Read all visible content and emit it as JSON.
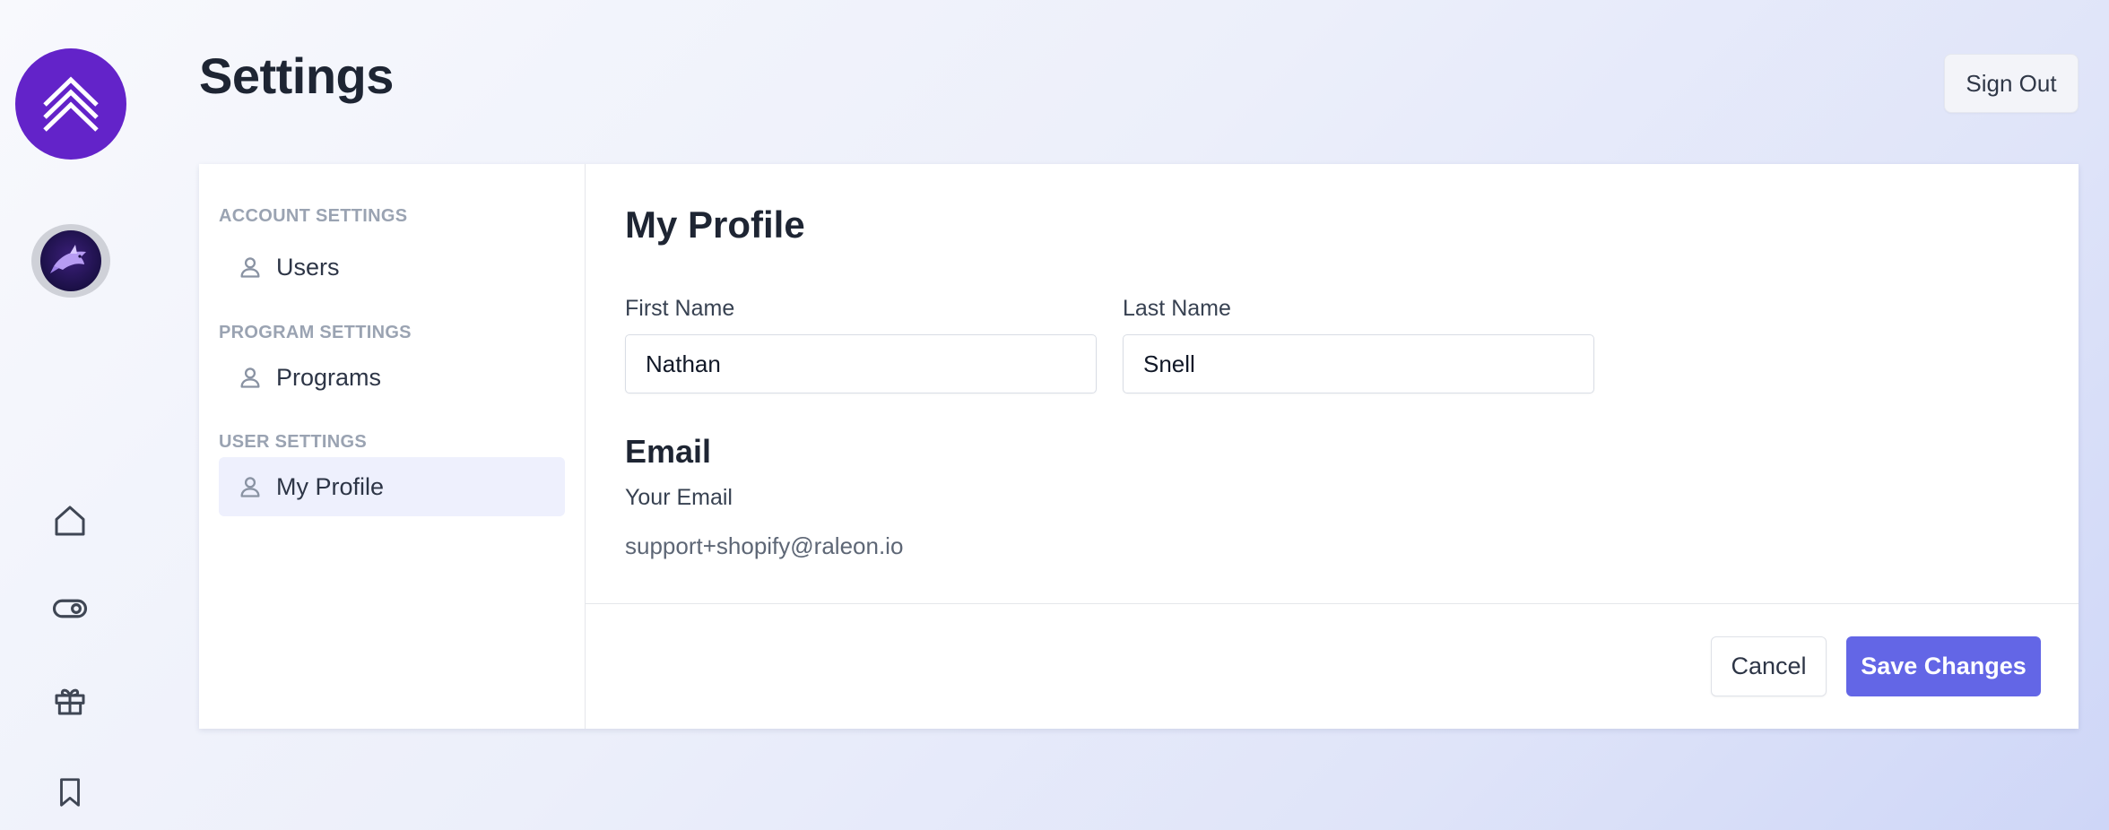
{
  "page": {
    "title": "Settings",
    "sign_out_label": "Sign Out"
  },
  "rail": {
    "icons": [
      "app-logo-icon",
      "shark-avatar-icon",
      "home-icon",
      "toggle-icon",
      "gift-icon",
      "bookmark-icon"
    ],
    "brand_color": "#6323c9"
  },
  "nav": {
    "sections": [
      {
        "title": "ACCOUNT SETTINGS",
        "items": [
          {
            "label": "Users",
            "icon": "user-icon"
          }
        ]
      },
      {
        "title": "PROGRAM SETTINGS",
        "items": [
          {
            "label": "Programs",
            "icon": "user-icon"
          }
        ]
      },
      {
        "title": "USER SETTINGS",
        "items": [
          {
            "label": "My Profile",
            "icon": "user-icon",
            "active": true
          }
        ]
      }
    ]
  },
  "profile": {
    "heading": "My Profile",
    "first_name_label": "First Name",
    "first_name_value": "Nathan",
    "last_name_label": "Last Name",
    "last_name_value": "Snell",
    "email_heading": "Email",
    "email_label": "Your Email",
    "email_value": "support+shopify@raleon.io"
  },
  "actions": {
    "cancel_label": "Cancel",
    "save_label": "Save Changes",
    "accent_color": "#6366e6"
  }
}
